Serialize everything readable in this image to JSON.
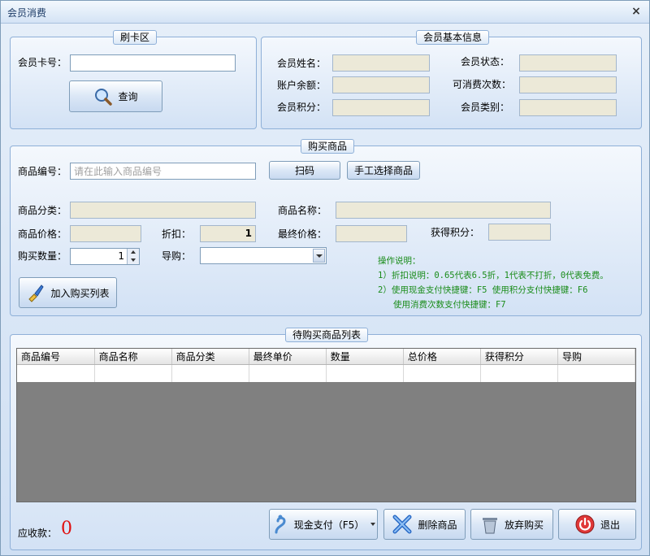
{
  "window": {
    "title": "会员消费",
    "close_glyph": "×"
  },
  "card_area": {
    "legend": "刷卡区",
    "card_label": "会员卡号：",
    "card_value": "",
    "query_button": "查询"
  },
  "member_info": {
    "legend": "会员基本信息",
    "name_label": "会员姓名：",
    "status_label": "会员状态：",
    "balance_label": "账户余额：",
    "times_label": "可消费次数：",
    "points_label": "会员积分：",
    "type_label": "会员类别："
  },
  "purchase": {
    "legend": "购买商品",
    "code_label": "商品编号：",
    "code_placeholder": "请在此输入商品编号",
    "scan_button": "扫码",
    "manual_button": "手工选择商品",
    "category_label": "商品分类：",
    "name_label": "商品名称：",
    "price_label": "商品价格：",
    "discount_label": "折扣：",
    "discount_value": "1",
    "final_price_label": "最终价格：",
    "earned_points_label": "获得积分：",
    "qty_label": "购买数量：",
    "qty_value": "1",
    "guide_label": "导购：",
    "add_button": "加入购买列表",
    "notes": [
      "操作说明：",
      "1）折扣说明：0.65代表6.5折，1代表不打折，0代表免费。",
      "2）使用现金支付快捷键：F5    使用积分支付快捷键：F6",
      "   使用消费次数支付快捷键：F7"
    ]
  },
  "cart": {
    "legend": "待购买商品列表",
    "columns": [
      "商品编号",
      "商品名称",
      "商品分类",
      "最终单价",
      "数量",
      "总价格",
      "获得积分",
      "导购"
    ]
  },
  "footer": {
    "due_label": "应收款：",
    "due_value": "0",
    "cash_pay_button": "现金支付（F5）",
    "delete_button": "删除商品",
    "abandon_button": "放弃购买",
    "exit_button": "退出"
  },
  "colors": {
    "due_value": "#e01010",
    "note_text": "#1a8c1a"
  }
}
